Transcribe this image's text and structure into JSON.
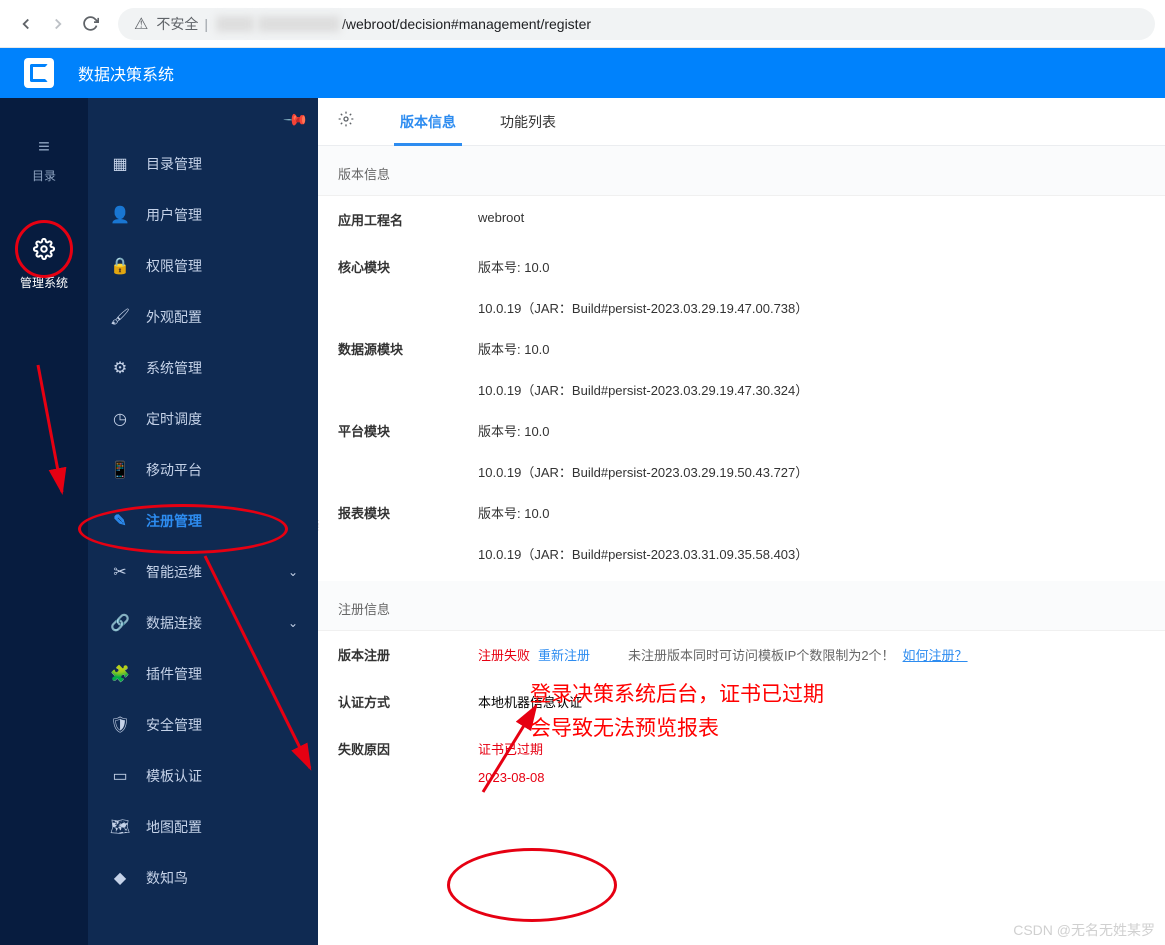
{
  "browser": {
    "insecure_label": "不安全",
    "url_path": "/webroot/decision#management/register"
  },
  "header": {
    "app_title": "数据决策系统"
  },
  "rail": {
    "items": [
      {
        "icon": "≡",
        "label": "目录"
      },
      {
        "icon": "⚙",
        "label": "管理系统"
      }
    ]
  },
  "sidebar": {
    "items": [
      {
        "icon": "▦",
        "label": "目录管理"
      },
      {
        "icon": "👤",
        "label": "用户管理"
      },
      {
        "icon": "🔒",
        "label": "权限管理"
      },
      {
        "icon": "🖌",
        "label": "外观配置"
      },
      {
        "icon": "⚙",
        "label": "系统管理"
      },
      {
        "icon": "◷",
        "label": "定时调度"
      },
      {
        "icon": "📱",
        "label": "移动平台"
      },
      {
        "icon": "✎",
        "label": "注册管理"
      },
      {
        "icon": "✂",
        "label": "智能运维",
        "sub": true
      },
      {
        "icon": "🔗",
        "label": "数据连接",
        "sub": true
      },
      {
        "icon": "🧩",
        "label": "插件管理"
      },
      {
        "icon": "🛡",
        "label": "安全管理"
      },
      {
        "icon": "▭",
        "label": "模板认证"
      },
      {
        "icon": "🗺",
        "label": "地图配置"
      },
      {
        "icon": "◆",
        "label": "数知鸟"
      }
    ]
  },
  "tabs": {
    "t1": "版本信息",
    "t2": "功能列表"
  },
  "version_section": {
    "title": "版本信息",
    "rows": {
      "app_project_label": "应用工程名",
      "app_project_value": "webroot",
      "core_label": "核心模块",
      "core_ver": "版本号: 10.0",
      "core_build": "10.0.19（JAR：Build#persist-2023.03.29.19.47.00.738）",
      "ds_label": "数据源模块",
      "ds_ver": "版本号: 10.0",
      "ds_build": "10.0.19（JAR：Build#persist-2023.03.29.19.47.30.324）",
      "plat_label": "平台模块",
      "plat_ver": "版本号: 10.0",
      "plat_build": "10.0.19（JAR：Build#persist-2023.03.29.19.50.43.727）",
      "report_label": "报表模块",
      "report_ver": "版本号: 10.0",
      "report_build": "10.0.19（JAR：Build#persist-2023.03.31.09.35.58.403）"
    }
  },
  "register_section": {
    "title": "注册信息",
    "reg_label": "版本注册",
    "reg_fail": "注册失败",
    "reg_retry": "重新注册",
    "reg_note": "未注册版本同时可访问模板IP个数限制为2个！",
    "reg_how": "如何注册？",
    "auth_label": "认证方式",
    "auth_value": "本地机器信息认证",
    "fail_label": "失败原因",
    "fail_reason": "证书已过期",
    "fail_date": "2023-08-08"
  },
  "annotations": {
    "line1": "登录决策系统后台，证书已过期",
    "line2": "会导致无法预览报表"
  },
  "watermark": "CSDN @无名无姓某罗"
}
